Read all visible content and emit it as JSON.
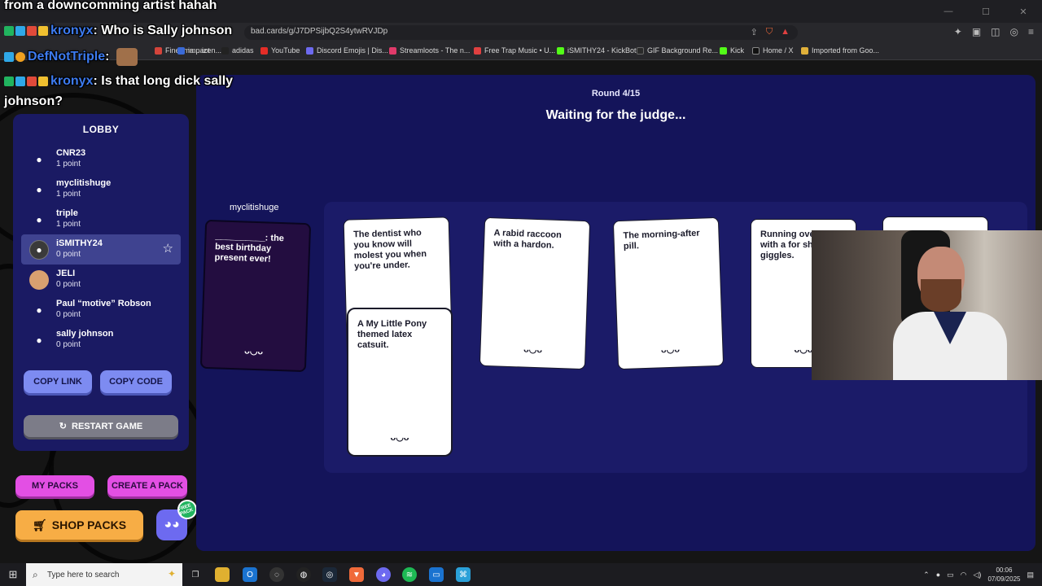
{
  "browser": {
    "url": "bad.cards/g/J7DPSijbQ2S4ytwRVJDp",
    "bookmarks": [
      {
        "label": "Fine Ima... izen...",
        "color": "#d4443b"
      },
      {
        "label": "impact",
        "color": "#3a6ad8"
      },
      {
        "label": "adidas",
        "color": "#222"
      },
      {
        "label": "YouTube",
        "color": "#e52d27"
      },
      {
        "label": "Discord Emojis | Dis...",
        "color": "#6d6af0"
      },
      {
        "label": "Streamloots - The n...",
        "color": "#e03a6a"
      },
      {
        "label": "Free Trap Music • U...",
        "color": "#e04040"
      },
      {
        "label": "iSMITHY24 - KickBot",
        "color": "#53fc18"
      },
      {
        "label": "GIF Background Re...",
        "color": "#2a2a2a"
      },
      {
        "label": "Kick",
        "color": "#53fc18"
      },
      {
        "label": "Home / X",
        "color": "#111"
      },
      {
        "label": "Imported from Goo...",
        "color": "#e0b03a"
      }
    ]
  },
  "chat": [
    {
      "user": "",
      "message": "from a downcomming artist hahah"
    },
    {
      "user": "kronyx",
      "message": ": Who is Sally johnson"
    },
    {
      "user": "DefNotTriple",
      "message": ":"
    },
    {
      "user": "kronyx",
      "message": ": Is that long dick sally"
    },
    {
      "user": "",
      "message": "johnson?"
    }
  ],
  "lobby": {
    "title": "LOBBY",
    "players": [
      {
        "name": "CNR23",
        "score": "1 point",
        "avatar": "person-icon"
      },
      {
        "name": "myclitishuge",
        "score": "1 point",
        "avatar": "person-icon"
      },
      {
        "name": "triple",
        "score": "1 point",
        "avatar": "person-icon"
      },
      {
        "name": "iSMITHY24",
        "score": "0 point",
        "avatar": "photo"
      },
      {
        "name": "JELI",
        "score": "0 point",
        "avatar": "photo"
      },
      {
        "name": "Paul “motive” Robson",
        "score": "0 point",
        "avatar": "person-icon"
      },
      {
        "name": "sally johnson",
        "score": "0 point",
        "avatar": "person-icon"
      }
    ],
    "copy_link": "COPY LINK",
    "copy_code": "COPY CODE",
    "restart": "RESTART GAME"
  },
  "bottom_buttons": {
    "my_packs": "MY PACKS",
    "create_pack": "CREATE A PACK",
    "shop_packs": "SHOP PACKS",
    "free_badge": "FREE PACK"
  },
  "game": {
    "round": "Round 4/15",
    "status": "Waiting for the judge...",
    "judge": "myclitishuge",
    "black_card": "__________: the best birthday present ever!",
    "white_cards": [
      "The dentist who you know will molest you when you're under.",
      "A My Little Pony themed latex catsuit.",
      "A rabid raccoon with a hardon.",
      "The morning-after pill.",
      "Running ove child with a for shits an giggles."
    ],
    "card_face": "ᴗ◡ᴗ"
  },
  "taskbar": {
    "search_placeholder": "Type here to search",
    "time": "00:06",
    "date": "07/09/2025"
  },
  "colors": {
    "board": "#14145a",
    "lobby": "#1a1a63",
    "accent_blue": "#7d8bf1",
    "pink": "#e34fe4",
    "orange": "#f7ad45"
  }
}
